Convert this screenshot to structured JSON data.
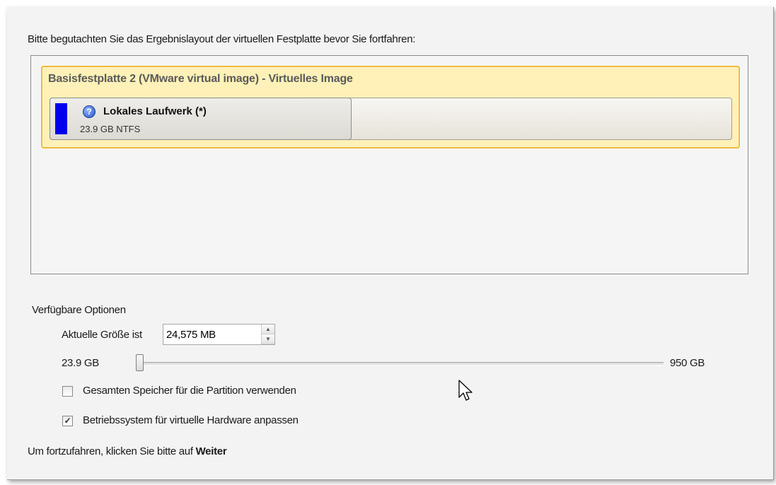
{
  "instruction": "Bitte begutachten Sie das Ergebnislayout der virtuellen Festplatte bevor Sie fortfahren:",
  "disk": {
    "title": "Basisfestplatte 2 (VMware virtual image) - Virtuelles Image",
    "partition": {
      "name": "Lokales Laufwerk (*)",
      "size_fs": "23.9 GB NTFS",
      "color": "#0000ee",
      "icon": "help-icon",
      "icon_glyph": "?"
    }
  },
  "options": {
    "heading": "Verfügbare Optionen",
    "size_label": "Aktuelle Größe ist",
    "size_value": "24,575 MB",
    "slider": {
      "min_label": "23.9 GB",
      "max_label": "950 GB",
      "position_fraction": 0.0
    },
    "checkboxes": [
      {
        "label": "Gesamten Speicher für die Partition verwenden",
        "checked": false
      },
      {
        "label": "Betriebssystem für virtuelle Hardware anpassen",
        "checked": true
      }
    ]
  },
  "footer": {
    "prefix": "Um fortzufahren, klicken Sie bitte auf ",
    "action": "Weiter"
  },
  "colors": {
    "disk_highlight": "#fff1b8",
    "disk_border": "#f0b93a"
  }
}
